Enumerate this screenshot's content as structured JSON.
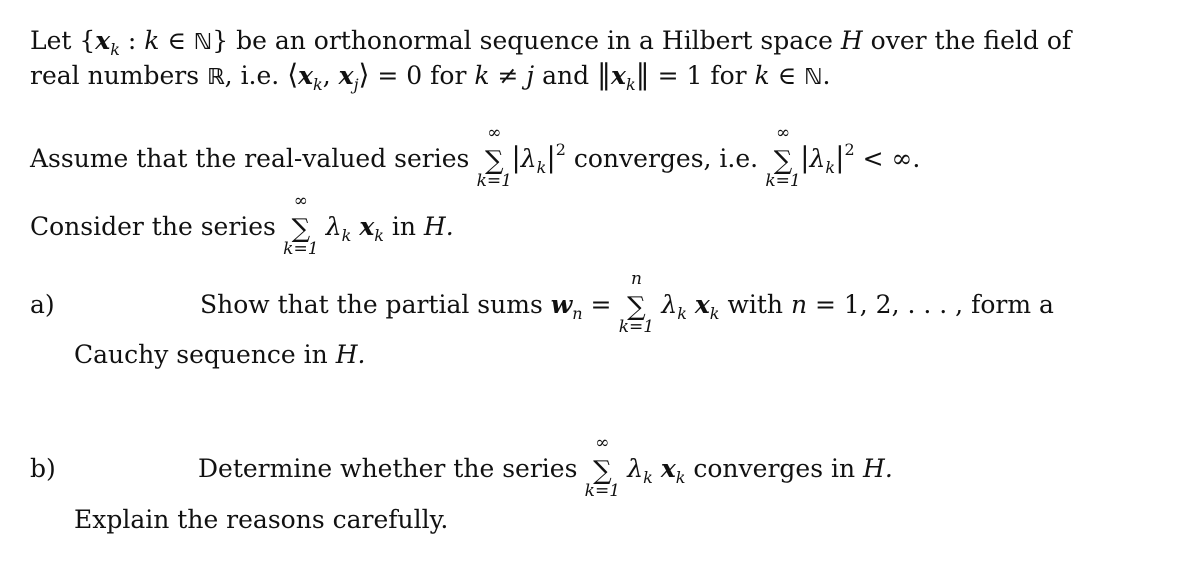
{
  "intro": {
    "line1_pre": "Let ",
    "line1_set_open": "{",
    "line1_x": "x",
    "line1_k": "k",
    "line1_colon": " : ",
    "line1_kvar": "k",
    "line1_in": " ∈ ",
    "line1_N": "ℕ",
    "line1_set_close": "}",
    "line1_post": " be an orthonormal sequence in a Hilbert space ",
    "line1_H": "H",
    "line1_end": " over the field of",
    "line2_pre": "real numbers ",
    "line2_R": "ℝ",
    "line2_ie": ", i.e. ",
    "line2_inner": "⟨x_k, x_j⟩ = 0",
    "line2_for": " for ",
    "line2_cond": "k ≠ j",
    "line2_and": " and ",
    "line2_norm": "‖x_k‖ = 1",
    "line2_for2": " for ",
    "line2_cond2": "k ∈ ℕ."
  },
  "assume": {
    "pre": "Assume that the real-valued series ",
    "sum_top": "∞",
    "sum_bot": "k=1",
    "term": "|λ_k|²",
    "mid": " converges, i.e. ",
    "term2": "|λ_k|² < ∞."
  },
  "consider": {
    "pre": "Consider the series ",
    "sum_top": "∞",
    "sum_bot": "k=1",
    "term": "λ_k x_k",
    "post": " in ",
    "H": "H."
  },
  "part_a": {
    "label": "a)",
    "pre": "Show that the partial sums ",
    "lhs": "w_n =",
    "sum_top": "n",
    "sum_bot": "k=1",
    "term": "λ_k x_k",
    "with": " with ",
    "range": "n = 1, 2, . . . ,",
    "post": " form a",
    "line2": "Cauchy sequence in ",
    "line2_H": "H."
  },
  "part_b": {
    "label": "b)",
    "pre": "Determine whether the series ",
    "sum_top": "∞",
    "sum_bot": "k=1",
    "term": "λ_k x_k",
    "post": " converges in ",
    "H": "H.",
    "line2": "Explain the reasons carefully."
  }
}
